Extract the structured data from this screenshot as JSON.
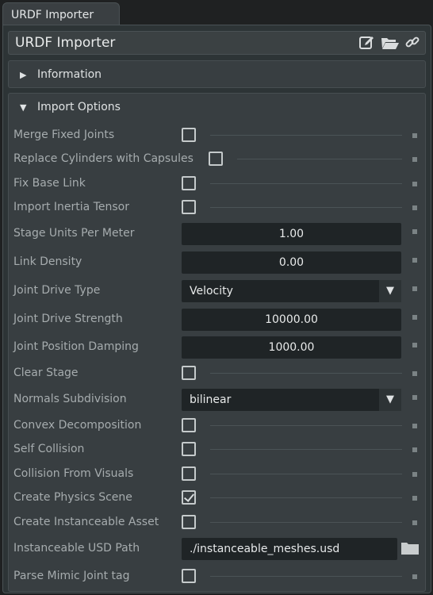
{
  "tab": {
    "label": "URDF Importer"
  },
  "title": {
    "text": "URDF Importer",
    "icons": [
      "edit-icon",
      "folder-open-icon",
      "link-icon"
    ]
  },
  "sections": {
    "information": {
      "label": "Information",
      "expanded": false
    },
    "import_options": {
      "label": "Import Options",
      "expanded": true
    }
  },
  "options": {
    "merge_fixed_joints": {
      "label": "Merge Fixed Joints",
      "checked": false
    },
    "replace_cylinders": {
      "label": "Replace Cylinders with Capsules",
      "checked": false
    },
    "fix_base_link": {
      "label": "Fix Base Link",
      "checked": false
    },
    "import_inertia_tensor": {
      "label": "Import Inertia Tensor",
      "checked": false
    },
    "stage_units": {
      "label": "Stage Units Per Meter",
      "value": "1.00"
    },
    "link_density": {
      "label": "Link Density",
      "value": "0.00"
    },
    "joint_drive_type": {
      "label": "Joint Drive Type",
      "value": "Velocity"
    },
    "joint_drive_strength": {
      "label": "Joint Drive Strength",
      "value": "10000.00"
    },
    "joint_position_damping": {
      "label": "Joint Position Damping",
      "value": "1000.00"
    },
    "clear_stage": {
      "label": "Clear Stage",
      "checked": false
    },
    "normals_subdivision": {
      "label": "Normals Subdivision",
      "value": "bilinear"
    },
    "convex_decomposition": {
      "label": "Convex Decomposition",
      "checked": false
    },
    "self_collision": {
      "label": "Self Collision",
      "checked": false
    },
    "collision_from_visuals": {
      "label": "Collision From Visuals",
      "checked": false
    },
    "create_physics_scene": {
      "label": "Create Physics Scene",
      "checked": true
    },
    "create_instanceable_asset": {
      "label": "Create Instanceable Asset",
      "checked": false
    },
    "instanceable_usd_path": {
      "label": "Instanceable USD Path",
      "value": "./instanceable_meshes.usd"
    },
    "parse_mimic": {
      "label": "Parse Mimic Joint tag",
      "checked": false
    }
  },
  "colors": {
    "background": "#2d3436",
    "field": "#1f2426",
    "label": "#a6acae",
    "text": "#e8eaea"
  }
}
